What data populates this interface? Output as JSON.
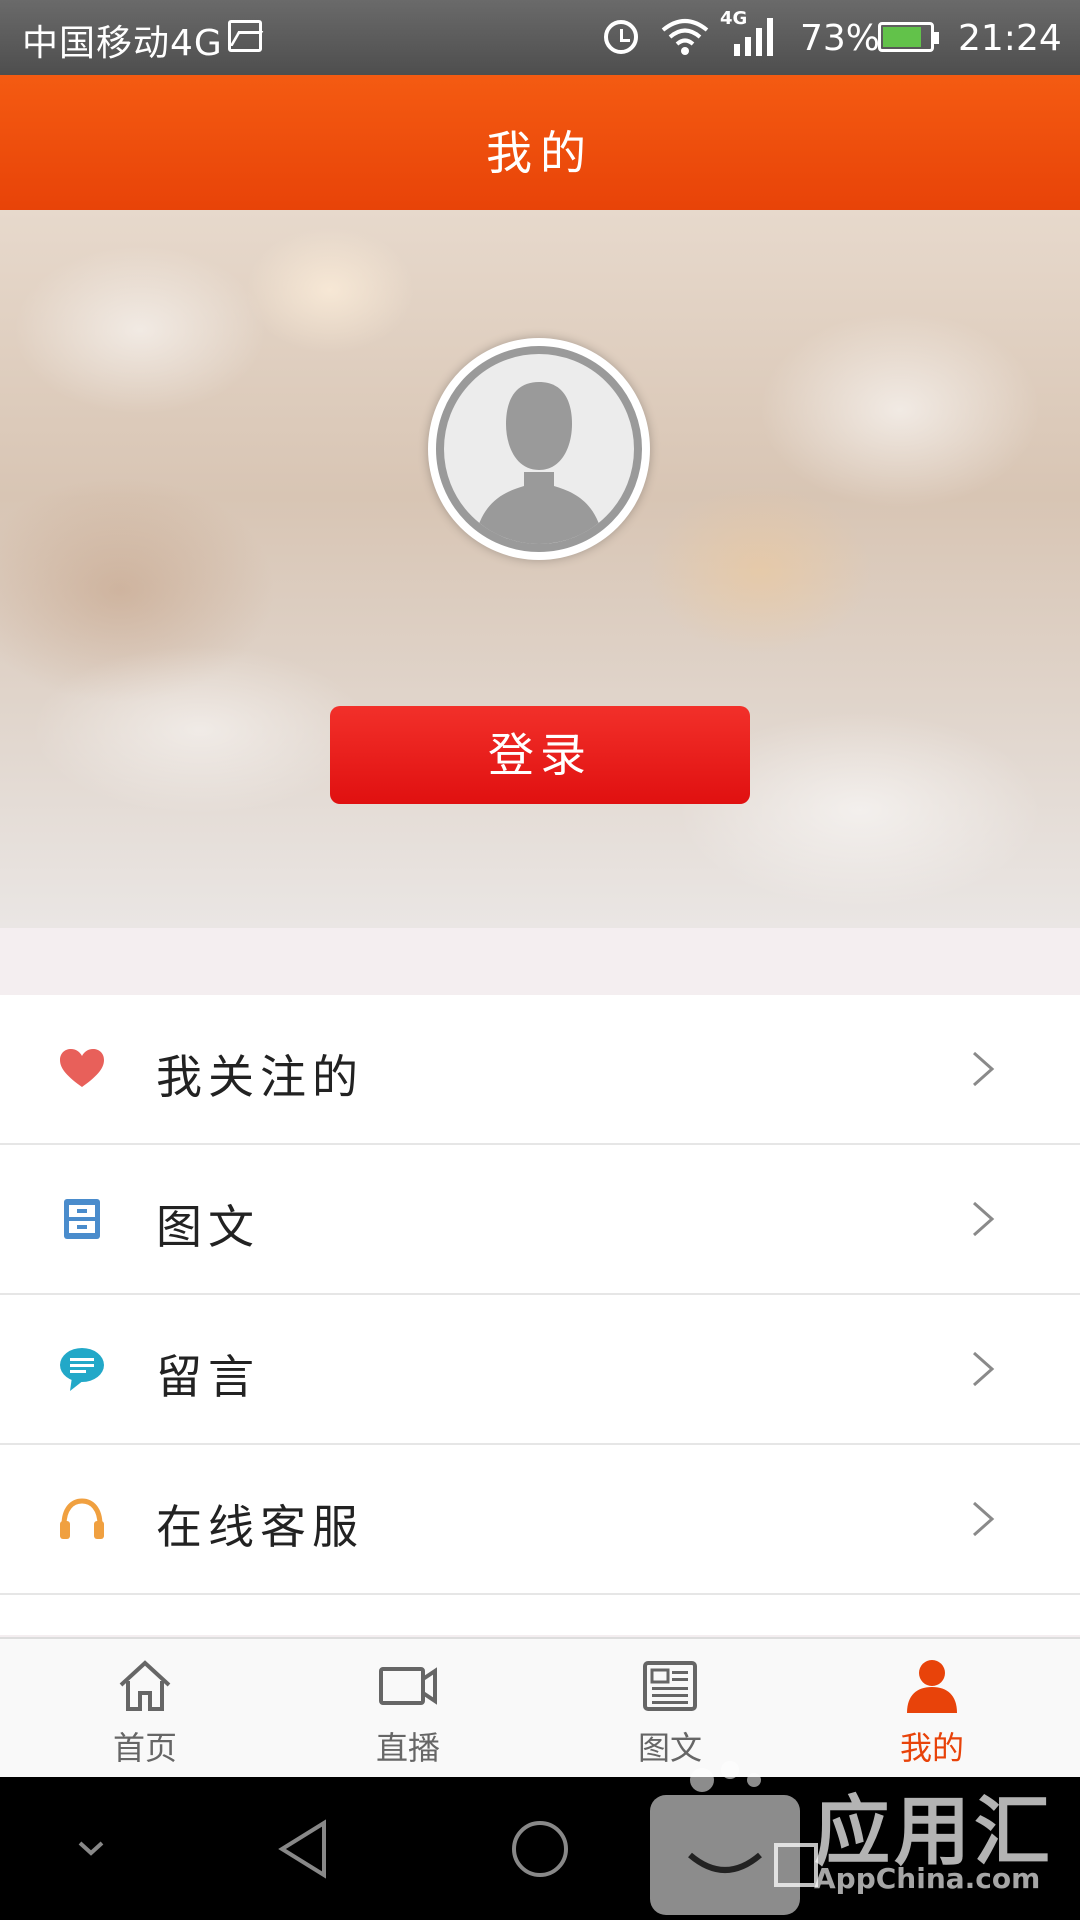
{
  "status_bar": {
    "carrier": "中国移动4G",
    "network_badge": "4G",
    "battery_percent": "73%",
    "time": "21:24",
    "icons": [
      "image-icon",
      "alarm-icon",
      "wifi-icon",
      "signal-icon",
      "battery-charging-icon"
    ]
  },
  "header": {
    "title": "我的"
  },
  "profile": {
    "login_label": "登录",
    "avatar_icon": "default-user-avatar"
  },
  "menu": {
    "items": [
      {
        "label": "我关注的",
        "icon": "heart-icon",
        "color": "#e8605a"
      },
      {
        "label": "图文",
        "icon": "cabinet-icon",
        "color": "#4a8ccc"
      },
      {
        "label": "留言",
        "icon": "chat-bubble-icon",
        "color": "#22a8c8"
      },
      {
        "label": "在线客服",
        "icon": "headphones-icon",
        "color": "#f0a040"
      }
    ]
  },
  "bottom_nav": {
    "items": [
      {
        "label": "首页",
        "icon": "home-icon",
        "active": false
      },
      {
        "label": "直播",
        "icon": "video-camera-icon",
        "active": false
      },
      {
        "label": "图文",
        "icon": "newspaper-icon",
        "active": false
      },
      {
        "label": "我的",
        "icon": "user-icon",
        "active": true
      }
    ],
    "active_color": "#e8430a"
  },
  "watermark": {
    "text": "应用汇",
    "sub": "AppChina.com"
  }
}
